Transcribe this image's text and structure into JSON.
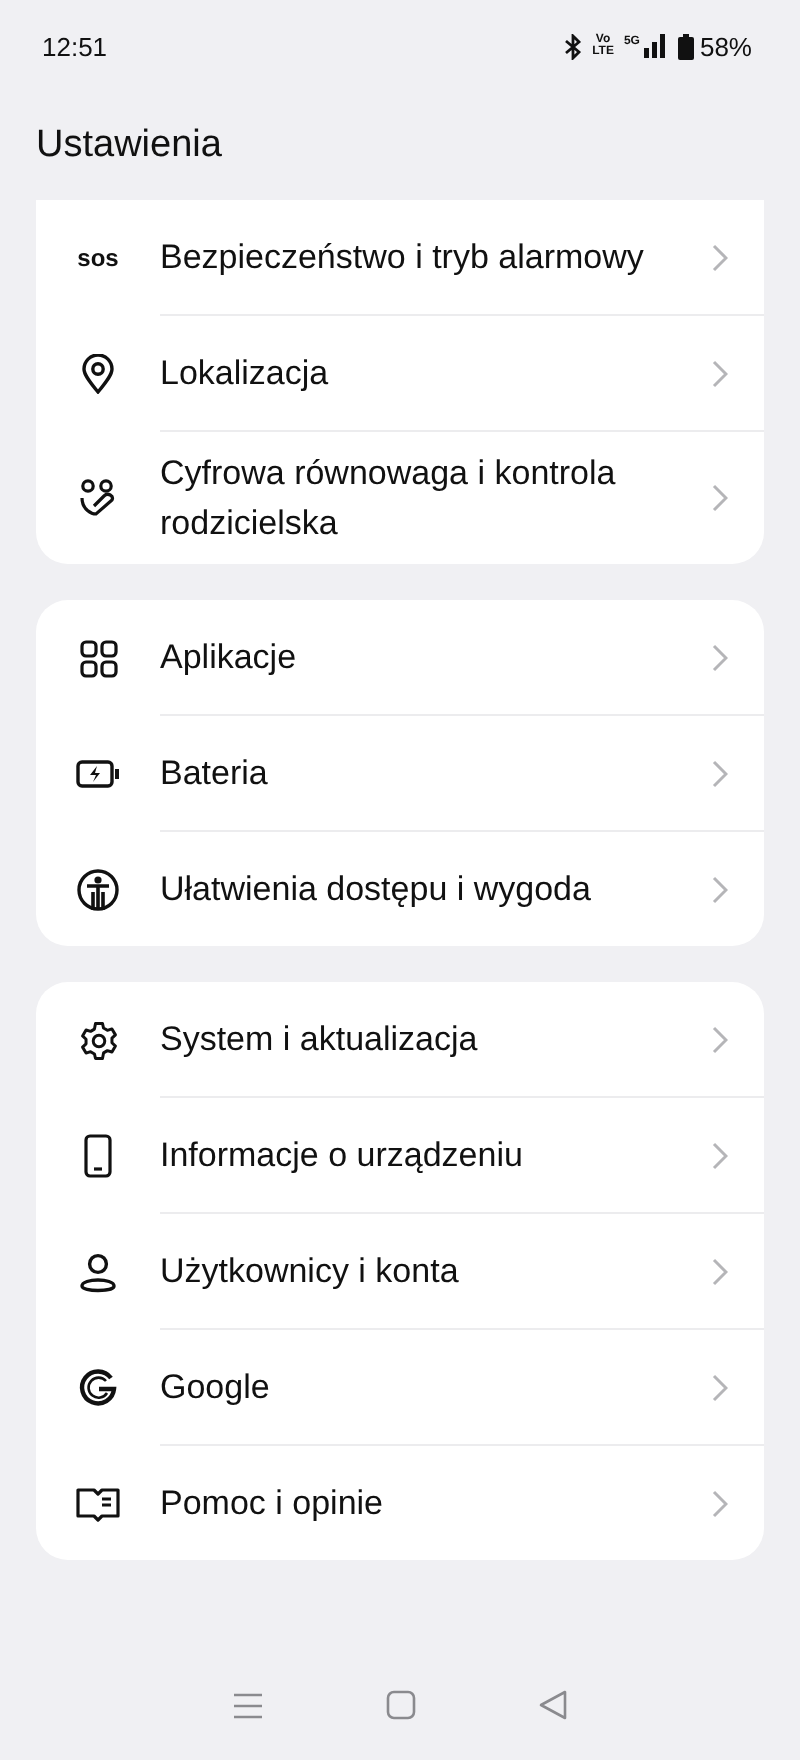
{
  "status_bar": {
    "time": "12:51",
    "volte": [
      "Vo",
      "LTE"
    ],
    "network": "5G",
    "battery": "58%"
  },
  "title": "Ustawienia",
  "groups": [
    {
      "items": [
        {
          "kind": "sos",
          "icon_text": "sos",
          "label": "Bezpieczeństwo i tryb alarmowy"
        },
        {
          "kind": "location",
          "label": "Lokalizacja"
        },
        {
          "kind": "wellbeing",
          "label": "Cyfrowa równowaga i kontrola rodzicielska"
        }
      ]
    },
    {
      "items": [
        {
          "kind": "apps",
          "label": "Aplikacje"
        },
        {
          "kind": "battery",
          "label": "Bateria"
        },
        {
          "kind": "accessibility",
          "label": "Ułatwienia dostępu i wygoda"
        }
      ]
    },
    {
      "items": [
        {
          "kind": "gear",
          "label": "System i aktualizacja"
        },
        {
          "kind": "phone",
          "label": "Informacje o urządzeniu"
        },
        {
          "kind": "user",
          "label": "Użytkownicy i konta"
        },
        {
          "kind": "google",
          "label": "Google"
        },
        {
          "kind": "help",
          "label": "Pomoc i opinie"
        }
      ]
    }
  ]
}
